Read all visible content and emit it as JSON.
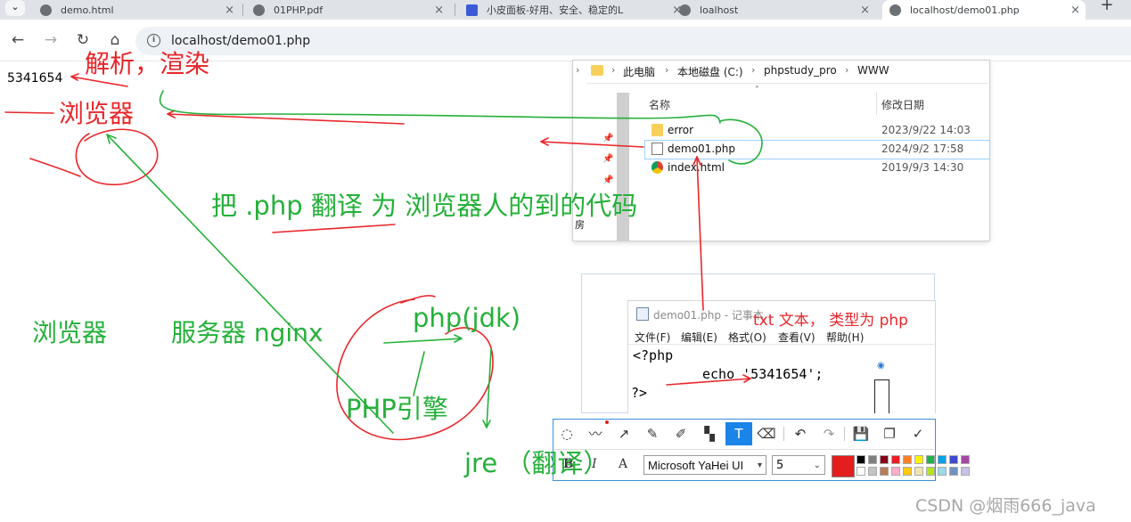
{
  "browser": {
    "tabs": [
      {
        "title": "demo.html"
      },
      {
        "title": "01PHP.pdf"
      },
      {
        "title": "小皮面板-好用、安全、稳定的L"
      },
      {
        "title": "loalhost"
      },
      {
        "title": "localhost/demo01.php"
      }
    ],
    "url": "localhost/demo01.php"
  },
  "page": {
    "output_text": "5341654"
  },
  "explorer": {
    "breadcrumb": [
      "此电脑",
      "本地磁盘 (C:)",
      "phpstudy_pro",
      "WWW"
    ],
    "columns": {
      "name": "名称",
      "modified": "修改日期"
    },
    "nav_label": "房",
    "files": [
      {
        "name": "error",
        "date": "2023/9/22 14:03",
        "icon": "folder-icon"
      },
      {
        "name": "demo01.php",
        "date": "2024/9/2 17:58",
        "icon": "php-file-icon"
      },
      {
        "name": "index.html",
        "date": "2019/9/3 14:30",
        "icon": "chrome-file-icon"
      }
    ]
  },
  "notepad": {
    "title": "demo01.php - 记事本",
    "menu": [
      "文件(F)",
      "编辑(E)",
      "格式(O)",
      "查看(V)",
      "帮助(H)"
    ],
    "lines": [
      "<?php",
      "echo '5341654';",
      "?>"
    ]
  },
  "snip_toolbar": {
    "font": "Microsoft YaHei UI",
    "size": "5",
    "format": {
      "bold": "B",
      "italic": "I",
      "font_style": "A"
    },
    "tools": [
      "shape-icon",
      "pen-icon",
      "arrow-icon",
      "pencil-icon",
      "marker-icon",
      "mosaic-icon",
      "text-icon",
      "eraser-icon",
      "undo-icon",
      "redo-icon",
      "save-icon",
      "copy-icon",
      "done-icon"
    ],
    "current_color": "#e41e1e",
    "palette": [
      "#000000",
      "#7f7f7f",
      "#880015",
      "#ed1c24",
      "#ff7f27",
      "#fff200",
      "#22b14c",
      "#00a2e8",
      "#3f48cc",
      "#a349a4",
      "#ffffff",
      "#c3c3c3",
      "#b97a57",
      "#ffaec9",
      "#ffc90e",
      "#efe4b0",
      "#b5e61d",
      "#99d9ea",
      "#7092be",
      "#c8bfe7"
    ]
  },
  "annotations": {
    "parse_render": "解析，渲染",
    "browser_red": "浏览器",
    "translate_note": "把  .php  翻译 为 浏览器人的到的代码",
    "browser_green": "浏览器",
    "server": "服务器 nginx",
    "php_jdk": "php(jdk)",
    "php_engine": "PHP引擎",
    "jre": "jre  （翻译）",
    "txt_note": "txt 文本， 类型为 php"
  },
  "watermark": "CSDN @烟雨666_java"
}
